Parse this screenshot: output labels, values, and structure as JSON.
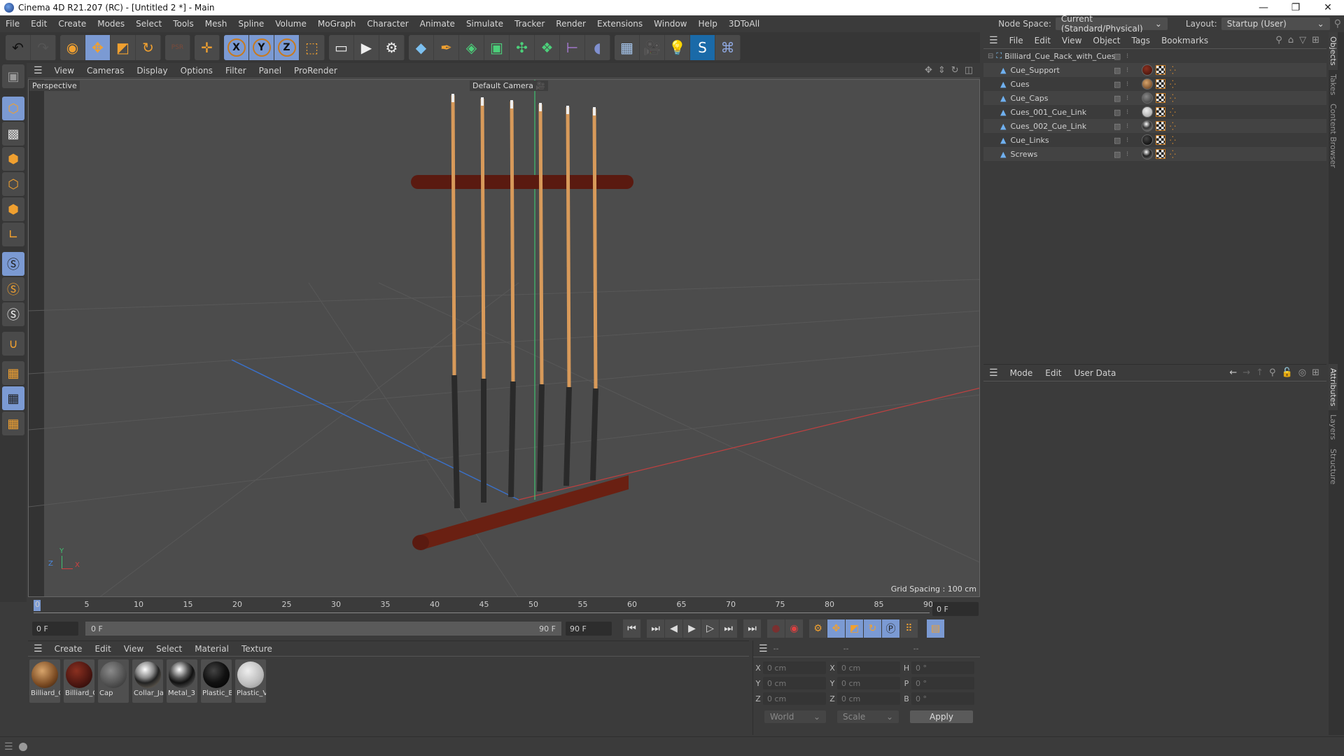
{
  "window": {
    "title": "Cinema 4D R21.207 (RC) - [Untitled 2 *] - Main",
    "minimize": "—",
    "maximize": "❐",
    "close": "✕"
  },
  "menu": [
    "File",
    "Edit",
    "Create",
    "Modes",
    "Select",
    "Tools",
    "Mesh",
    "Spline",
    "Volume",
    "MoGraph",
    "Character",
    "Animate",
    "Simulate",
    "Tracker",
    "Render",
    "Extensions",
    "Window",
    "Help",
    "3DToAll"
  ],
  "node_space": {
    "label": "Node Space:",
    "value": "Current (Standard/Physical)"
  },
  "layout": {
    "label": "Layout:",
    "value": "Startup (User)"
  },
  "toolbar": {
    "undo": [
      "undo-icon",
      "redo-icon"
    ],
    "tools": [
      {
        "name": "live-selection-icon",
        "glyph": "◉",
        "selected": false
      },
      {
        "name": "move-tool-icon",
        "glyph": "✥",
        "selected": true
      },
      {
        "name": "scale-tool-icon",
        "glyph": "◩",
        "selected": false
      },
      {
        "name": "rotate-tool-icon",
        "glyph": "↻",
        "selected": false
      }
    ],
    "psr": "PSR",
    "axes": [
      "X",
      "Y",
      "Z"
    ],
    "render": [
      "render-view-icon",
      "render-picture-viewer-icon",
      "render-settings-icon"
    ],
    "create": [
      "cube-icon",
      "pen-icon",
      "subdivision-icon",
      "extrude-icon",
      "cloner-icon",
      "mograph-icon",
      "deformer-icon",
      "field-icon",
      "floor-icon",
      "camera-icon",
      "light-icon",
      "3dtoall-icon",
      "python-icon"
    ]
  },
  "viewport": {
    "menu": [
      "View",
      "Cameras",
      "Display",
      "Options",
      "Filter",
      "Panel",
      "ProRender"
    ],
    "label": "Perspective",
    "camera": "Default Camera",
    "grid_spacing": "Grid Spacing : 100 cm",
    "axis_labels": {
      "x": "X",
      "y": "Y",
      "z": "Z"
    }
  },
  "timeline": {
    "ticks": [
      "0",
      "5",
      "10",
      "15",
      "20",
      "25",
      "30",
      "35",
      "40",
      "45",
      "50",
      "55",
      "60",
      "65",
      "70",
      "75",
      "80",
      "85",
      "90"
    ],
    "current_frame": "0 F",
    "start": "0 F",
    "range_start": "0 F",
    "range_end": "90 F",
    "end": "90 F"
  },
  "materials": {
    "menu": [
      "Create",
      "Edit",
      "View",
      "Select",
      "Material",
      "Texture"
    ],
    "items": [
      {
        "name": "Billiard_C",
        "color": "radial-gradient(circle at 40% 35%,#d7a46b,#7a4a22 60%,#2a1a0e)"
      },
      {
        "name": "Billiard_C",
        "color": "radial-gradient(circle at 40% 35%,#8a3020,#4a1510 60%,#1e0806)"
      },
      {
        "name": "Cap",
        "color": "radial-gradient(circle at 40% 35%,#8a8a8a,#4f4f4f 60%,#2a2a2a)"
      },
      {
        "name": "Collar_Ja",
        "color": "radial-gradient(circle at 40% 30%,#fff,#888 35%,#222 55%,#8a8070)"
      },
      {
        "name": "Metal_3",
        "color": "radial-gradient(circle at 40% 30%,#fff,#555 35%,#111 55%,#777)"
      },
      {
        "name": "Plastic_B",
        "color": "radial-gradient(circle at 40% 35%,#444,#111 50%,#000)"
      },
      {
        "name": "Plastic_V",
        "color": "radial-gradient(circle at 40% 35%,#eee,#bbb 60%,#888)"
      }
    ]
  },
  "coordinates": {
    "headers": [
      "--",
      "--",
      "--"
    ],
    "rows": [
      {
        "a": "X",
        "av": "0 cm",
        "b": "X",
        "bv": "0 cm",
        "c": "H",
        "cv": "0 °"
      },
      {
        "a": "Y",
        "av": "0 cm",
        "b": "Y",
        "bv": "0 cm",
        "c": "P",
        "cv": "0 °"
      },
      {
        "a": "Z",
        "av": "0 cm",
        "b": "Z",
        "bv": "0 cm",
        "c": "B",
        "cv": "0 °"
      }
    ],
    "space": "World",
    "mode": "Scale",
    "apply": "Apply"
  },
  "objects": {
    "menu": [
      "File",
      "Edit",
      "View",
      "Object",
      "Tags",
      "Bookmarks"
    ],
    "root": "Billiard_Cue_Rack_with_Cues",
    "children": [
      {
        "name": "Cue_Support",
        "mat": "radial-gradient(circle at 40% 35%,#8a3020,#3a1008)"
      },
      {
        "name": "Cues",
        "mat": "radial-gradient(circle at 40% 35%,#d7a46b,#5a3418)"
      },
      {
        "name": "Cue_Caps",
        "mat": "radial-gradient(circle at 40% 35%,#888,#333)"
      },
      {
        "name": "Cues_001_Cue_Link",
        "mat": "radial-gradient(circle at 40% 35%,#eee,#999)"
      },
      {
        "name": "Cues_002_Cue_Link",
        "mat": "radial-gradient(circle at 40% 30%,#fff,#333 45%,#888)"
      },
      {
        "name": "Cue_Links",
        "mat": "radial-gradient(circle at 40% 35%,#444,#000)"
      },
      {
        "name": "Screws",
        "mat": "radial-gradient(circle at 40% 30%,#fff,#222 45%,#777)"
      }
    ]
  },
  "attributes": {
    "menu": [
      "Mode",
      "Edit",
      "User Data"
    ]
  },
  "side_tabs_top": [
    "Objects",
    "Takes",
    "Content Browser"
  ],
  "side_tabs_bottom": [
    "Attributes",
    "Layers",
    "Structure"
  ]
}
